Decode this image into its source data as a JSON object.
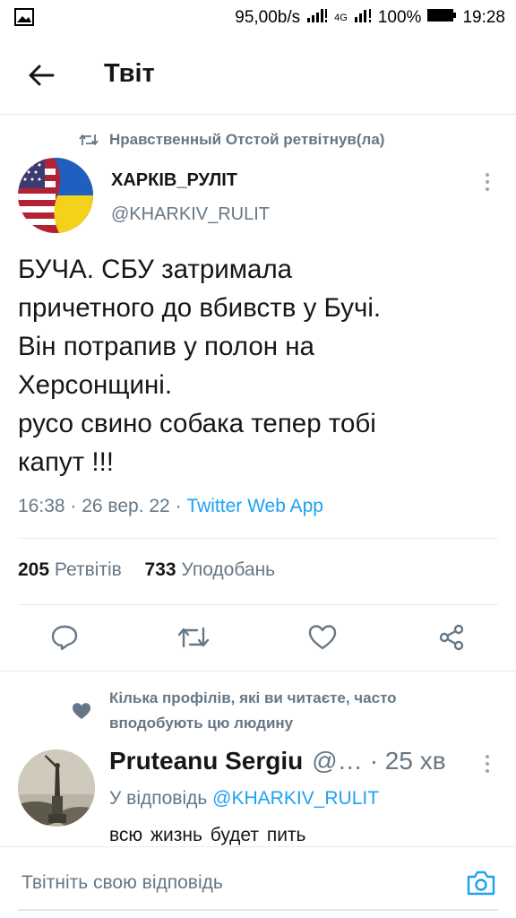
{
  "status_bar": {
    "speed": "95,00b/s",
    "network": "4G",
    "battery": "100%",
    "time": "19:28"
  },
  "header": {
    "title": "Твіт"
  },
  "retweet_context": "Нравственный Отстой ретвітнув(ла)",
  "tweet": {
    "author_name": "ХАРКІВ_РУЛІТ",
    "author_handle": "@KHARKIV_RULIT",
    "text_lines": [
      "БУЧА. СБУ затримала",
      "причетного до вбивств у Бучі.",
      "Він потрапив у полон на",
      "Херсонщині.",
      "русо свино собака тепер тобі",
      "капут !!!"
    ],
    "time": "16:38",
    "date": "26 вер. 22",
    "source": "Twitter Web App",
    "retweets_count": "205",
    "retweets_label": "Ретвітів",
    "likes_count": "733",
    "likes_label": "Уподобань"
  },
  "social_context": "Кілька профілів, які ви читаєте, часто вподобують цю людину",
  "reply": {
    "name": "Pruteanu Sergiu",
    "handle": "@…",
    "time": "· 25 хв",
    "reply_to_prefix": "У відповідь",
    "reply_to_handle": "@KHARKIV_RULIT",
    "text": "всю жизнь  будет  пить"
  },
  "compose": {
    "placeholder": "Твітніть свою відповідь"
  },
  "colors": {
    "accent": "#1da1f2",
    "text_primary": "#14171a",
    "text_secondary": "#657786",
    "divider": "#e6ecf0"
  },
  "icons": {
    "back": "arrow-left-icon",
    "retweet": "retweet-icon",
    "more": "more-vertical-icon",
    "reply": "reply-icon",
    "like": "heart-icon",
    "share": "share-icon",
    "social_heart": "heart-filled-icon",
    "camera": "camera-icon"
  }
}
